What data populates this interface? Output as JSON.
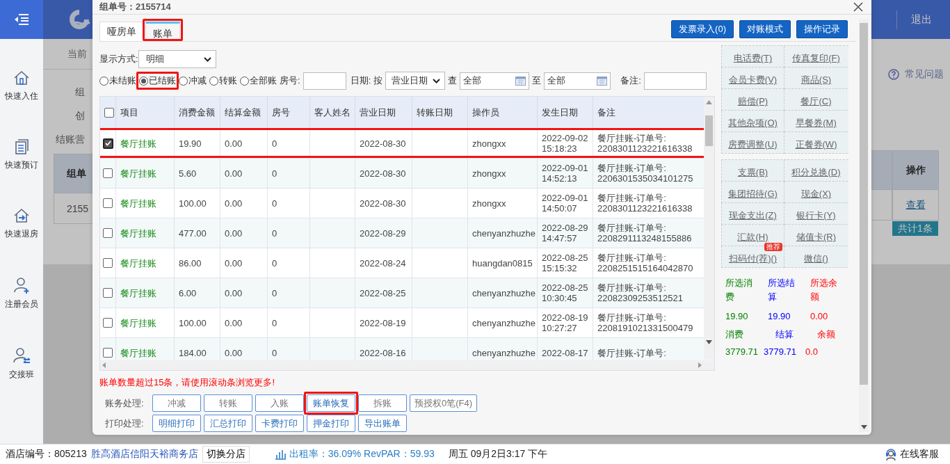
{
  "sidebar": {
    "items": [
      {
        "label": "快速入住",
        "kind": "checkin"
      },
      {
        "label": "快速预订",
        "kind": "booking"
      },
      {
        "label": "快速退房",
        "kind": "checkout"
      },
      {
        "label": "注册会员",
        "kind": "member"
      },
      {
        "label": "交接班",
        "kind": "shift"
      }
    ]
  },
  "header": {
    "logout": "退出"
  },
  "background": {
    "breadcrumb": "当前",
    "labels": [
      "组",
      "创",
      "结账营"
    ],
    "left_table": {
      "header": "组单",
      "cell": "2155"
    },
    "help": "常见问题",
    "right_table": {
      "header": "操作",
      "link": "查看"
    },
    "total": "共计1条"
  },
  "dialog": {
    "title": "组单号：2155714",
    "tabs": [
      {
        "label": "哑房单",
        "selected": false,
        "highlighted": false
      },
      {
        "label": "账单",
        "selected": true,
        "highlighted": true
      }
    ],
    "actions": [
      "发票录入(0)",
      "对账模式",
      "操作记录"
    ],
    "display_mode": {
      "label": "显示方式:",
      "value": "明细"
    },
    "filters": {
      "radios": [
        {
          "label": "未结账",
          "selected": false,
          "highlighted": false
        },
        {
          "label": "已结账",
          "selected": true,
          "highlighted": true
        },
        {
          "label": "冲减",
          "selected": false,
          "highlighted": false
        },
        {
          "label": "转账",
          "selected": false,
          "highlighted": false
        },
        {
          "label": "全部账",
          "selected": false,
          "highlighted": false
        }
      ],
      "room_label": "房号:",
      "date_label": "日期:",
      "by_label": "按",
      "date_type": "营业日期",
      "from_label": "查",
      "from": "全部",
      "to_label": "至",
      "to": "全部",
      "remark_label": "备注:"
    },
    "table": {
      "all_checked": false,
      "columns": [
        "项目",
        "消费金额",
        "结算金额",
        "房号",
        "客人姓名",
        "营业日期",
        "转账日期",
        "操作员",
        "发生日期",
        "备注"
      ],
      "rows": [
        {
          "checked": true,
          "highlighted": true,
          "item": "餐厅挂账",
          "amount": "19.90",
          "settled": "0.00",
          "room": "0",
          "business_date": "2022-08-30",
          "operator": "zhongxx",
          "occurred": [
            "2022-09-02",
            "15:18:23"
          ],
          "remark": [
            "餐厅挂账-订单号:",
            "2208301123221616338"
          ]
        },
        {
          "checked": false,
          "highlighted": false,
          "item": "餐厅挂账",
          "amount": "5.60",
          "settled": "0.00",
          "room": "0",
          "business_date": "2022-08-30",
          "operator": "zhongxx",
          "occurred": [
            "2022-09-01",
            "14:52:13"
          ],
          "remark": [
            "餐厅挂账-订单号:",
            "2206301535034101275"
          ]
        },
        {
          "checked": false,
          "highlighted": false,
          "item": "餐厅挂账",
          "amount": "100.00",
          "settled": "0.00",
          "room": "0",
          "business_date": "2022-08-30",
          "operator": "zhongxx",
          "occurred": [
            "2022-09-01",
            "14:50:07"
          ],
          "remark": [
            "餐厅挂账-订单号:",
            "2208301123221616338"
          ]
        },
        {
          "checked": false,
          "highlighted": false,
          "item": "餐厅挂账",
          "amount": "477.00",
          "settled": "0.00",
          "room": "0",
          "business_date": "2022-08-29",
          "operator": "chenyanzhuzhe",
          "occurred": [
            "2022-08-29",
            "14:47:57"
          ],
          "remark": [
            "餐厅挂账-订单号:",
            "2208291113248155886"
          ]
        },
        {
          "checked": false,
          "highlighted": false,
          "item": "餐厅挂账",
          "amount": "86.00",
          "settled": "0.00",
          "room": "0",
          "business_date": "2022-08-24",
          "operator": "huangdan0815",
          "occurred": [
            "2022-08-25",
            "15:15:32"
          ],
          "remark": [
            "餐厅挂账-订单号:",
            "2208251515164042870"
          ]
        },
        {
          "checked": false,
          "highlighted": false,
          "item": "餐厅挂账",
          "amount": "6.00",
          "settled": "0.00",
          "room": "0",
          "business_date": "2022-08-25",
          "operator": "chenyanzhuzhe",
          "occurred": [
            "2022-08-25",
            "10:30:45"
          ],
          "remark": [
            "餐厅挂账-订单号:",
            "22082309253512521"
          ]
        },
        {
          "checked": false,
          "highlighted": false,
          "item": "餐厅挂账",
          "amount": "100.00",
          "settled": "0.00",
          "room": "0",
          "business_date": "2022-08-19",
          "operator": "chenyanzhuzhe",
          "occurred": [
            "2022-08-19",
            "10:27:27"
          ],
          "remark": [
            "餐厅挂账-订单号:",
            "2208191021331500479"
          ]
        },
        {
          "checked": false,
          "highlighted": false,
          "item": "餐厅挂账",
          "amount": "184.00",
          "settled": "0.00",
          "room": "0",
          "business_date": "2022-08-16",
          "operator": "chenyanzhuzhe",
          "occurred": [
            "2022-08-17"
          ],
          "remark": [
            "餐厅挂账-订单号:"
          ]
        }
      ]
    },
    "warning": "账单数量超过15条，请使用滚动条浏览更多!",
    "account_ops": {
      "label": "账务处理:",
      "buttons": [
        {
          "label": "冲减",
          "disabled": true,
          "highlighted": false
        },
        {
          "label": "转账",
          "disabled": true,
          "highlighted": false
        },
        {
          "label": "入账",
          "disabled": true,
          "highlighted": false
        },
        {
          "label": "账单恢复",
          "disabled": false,
          "highlighted": true
        },
        {
          "label": "拆账",
          "disabled": true,
          "highlighted": false
        },
        {
          "label": "预授权0笔(F4)",
          "disabled": true,
          "highlighted": false
        }
      ]
    },
    "print_ops": {
      "label": "打印处理:",
      "buttons": [
        {
          "label": "明细打印",
          "disabled": false,
          "highlighted": false
        },
        {
          "label": "汇总打印",
          "disabled": false,
          "highlighted": false
        },
        {
          "label": "卡费打印",
          "disabled": false,
          "highlighted": false
        },
        {
          "label": "押金打印",
          "disabled": false,
          "highlighted": false
        },
        {
          "label": "导出账单",
          "disabled": false,
          "highlighted": false
        }
      ]
    },
    "quick_links": [
      {
        "links": [
          {
            "label": "电话费(T)"
          },
          {
            "label": "传真复印(F)"
          },
          {
            "label": "会员卡费(V)"
          },
          {
            "label": "商品(S)"
          },
          {
            "label": "赔偿(P)"
          },
          {
            "label": "餐厅(C)"
          },
          {
            "label": "其他杂项(O)"
          },
          {
            "label": "早餐券(M)"
          },
          {
            "label": "房费调整(U)"
          },
          {
            "label": "正餐券(W)"
          }
        ]
      },
      {
        "links": [
          {
            "label": "支票(B)"
          },
          {
            "label": "积分兑换(D)"
          },
          {
            "label": "集团招待(G)"
          },
          {
            "label": "现金(X)"
          },
          {
            "label": "现金支出(Z)"
          },
          {
            "label": "银行卡(Y)"
          },
          {
            "label": "汇款(H)"
          },
          {
            "label": "储值卡(R)"
          },
          {
            "label": "扫码付(荐)()",
            "badge": "推荐"
          },
          {
            "label": "微信()"
          }
        ]
      }
    ],
    "summary": [
      {
        "label": "所选消费",
        "value": "19.90",
        "kind": "consumption"
      },
      {
        "label": "所选结算",
        "value": "19.90",
        "kind": "settlement"
      },
      {
        "label": "所选余额",
        "value": "0.00",
        "kind": "balance"
      }
    ],
    "totals": [
      {
        "label": "消费",
        "value": "3779.71",
        "kind": "consumption"
      },
      {
        "label": "结算",
        "value": "3779.71",
        "kind": "settlement"
      },
      {
        "label": "余额",
        "value": "0.0",
        "kind": "balance"
      }
    ]
  },
  "status_bar": {
    "hotel_label": "酒店编号：805213",
    "hotel_name": "胜高酒店信阳天裕商务店",
    "switch": "切换分店",
    "occupancy": "出租率：36.09% RevPAR：59.93",
    "datetime": "周五 09月2日3:17 下午",
    "support": "在线客服"
  }
}
